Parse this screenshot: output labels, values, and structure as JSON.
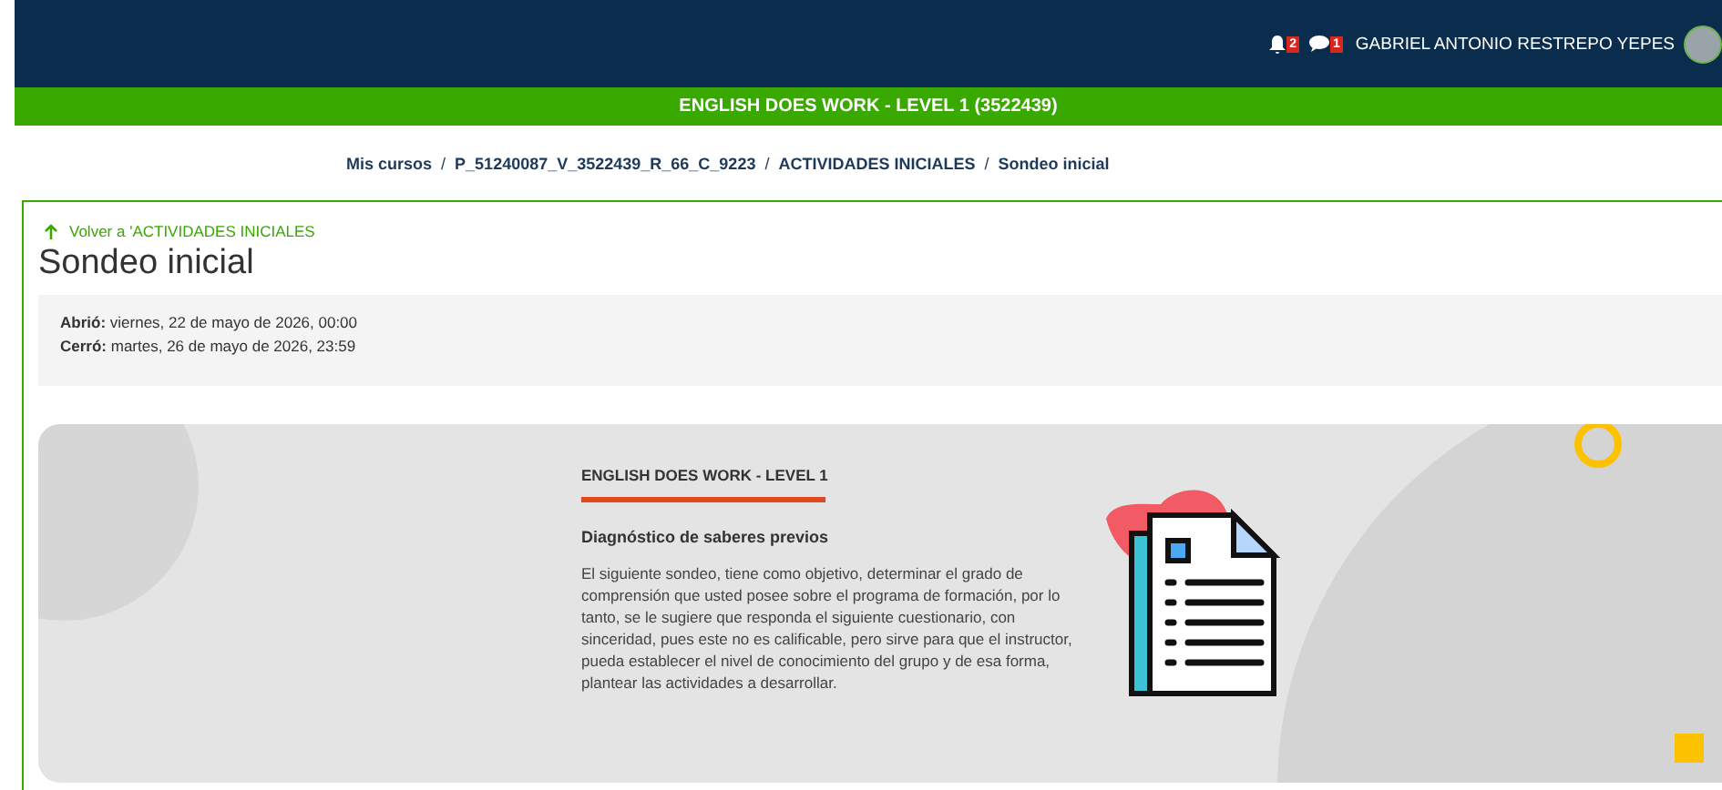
{
  "navbar": {
    "notifications": {
      "count": "2"
    },
    "messages": {
      "count": "1"
    },
    "user_name": "GABRIEL ANTONIO RESTREPO YEPES"
  },
  "course_bar": {
    "title": "ENGLISH DOES WORK - LEVEL 1 (3522439)"
  },
  "breadcrumb_separator": "/",
  "breadcrumb": [
    "Mis cursos",
    "P_51240087_V_3522439_R_66_C_9223",
    "ACTIVIDADES INICIALES",
    "Sondeo inicial"
  ],
  "back_link": "Volver a 'ACTIVIDADES INICIALES",
  "page_title": "Sondeo inicial",
  "dates": [
    {
      "label": "Abrió:",
      "value": "viernes, 22 de mayo de 2026, 00:00"
    },
    {
      "label": "Cerró:",
      "value": "martes, 26 de mayo de 2026, 23:59"
    }
  ],
  "banner": {
    "heading": "ENGLISH DOES WORK - LEVEL 1",
    "subtitle": "Diagnóstico de saberes previos",
    "body": "El siguiente sondeo, tiene como objetivo, determinar el grado de comprensión que usted posee sobre el programa de formación, por lo tanto, se le sugiere que responda el siguiente cuestionario, con sinceridad, pues este no es calificable, pero sirve para que el instructor, pueda establecer el nivel de conocimiento del grupo y de esa forma, plantear las actividades a desarrollar."
  }
}
